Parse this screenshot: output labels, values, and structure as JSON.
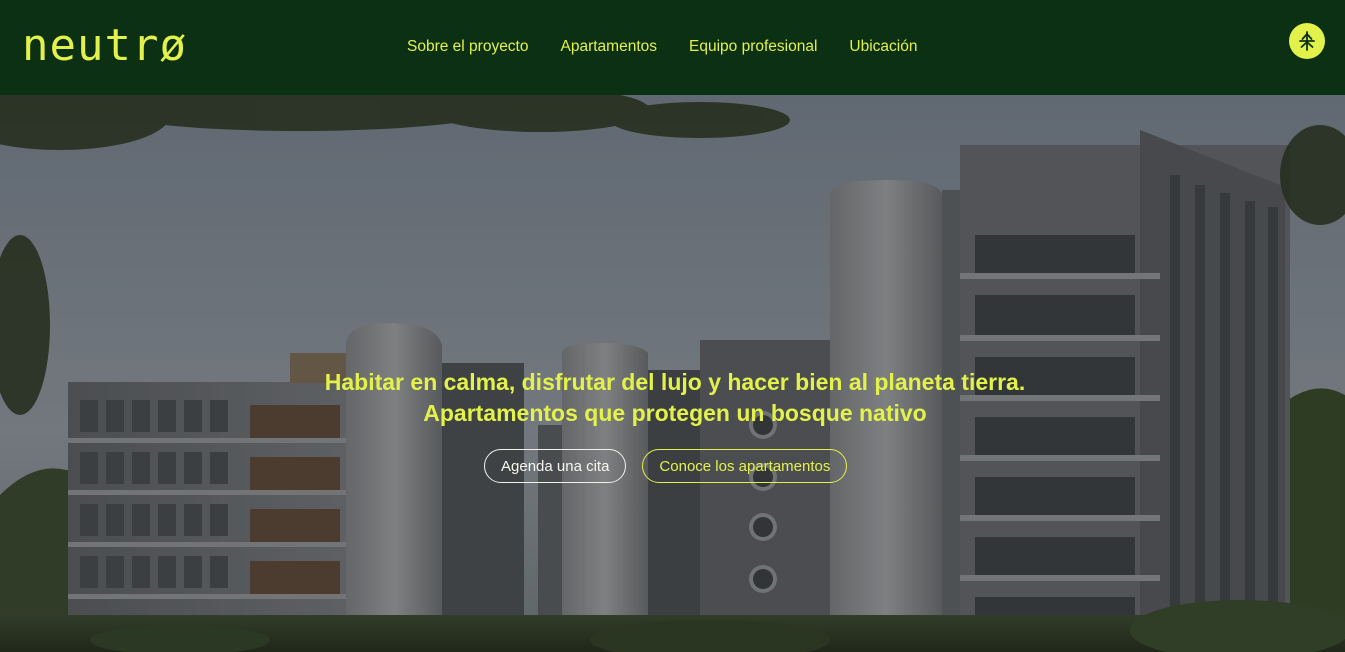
{
  "brand": {
    "logo_text": "neutrø",
    "accent_color": "#e3f24a",
    "nav_bg": "#0b3014"
  },
  "nav": {
    "items": [
      {
        "label": "Sobre el proyecto"
      },
      {
        "label": "Apartamentos"
      },
      {
        "label": "Equipo profesional"
      },
      {
        "label": "Ubicación"
      }
    ],
    "menu_icon": "tree-icon"
  },
  "hero": {
    "headline": "Habitar en calma, disfrutar del lujo y hacer bien al planeta tierra.",
    "subheadline": "Apartamentos que protegen un bosque nativo",
    "primary_cta": "Agenda una cita",
    "secondary_cta": "Conoce los apartamentos",
    "image": "architecture-render"
  }
}
